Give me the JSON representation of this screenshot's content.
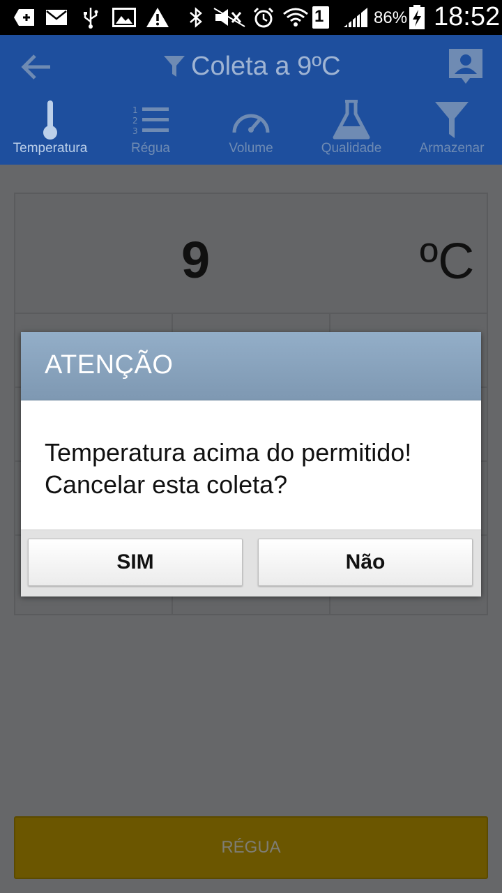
{
  "status_bar": {
    "battery_percent": "86%",
    "time": "18:52",
    "sim_slot": "1",
    "icons": [
      "add-notification-icon",
      "mail-icon",
      "usb-icon",
      "image-icon",
      "warning-icon",
      "bluetooth-icon",
      "mute-icon",
      "alarm-icon",
      "wifi-icon",
      "sim-icon",
      "signal-icon",
      "battery-charging-icon"
    ]
  },
  "appbar": {
    "title": "Coleta a 9ºC",
    "tabs": [
      {
        "label": "Temperatura",
        "icon": "thermometer-icon",
        "active": true
      },
      {
        "label": "Régua",
        "icon": "numbered-list-icon",
        "active": false
      },
      {
        "label": "Volume",
        "icon": "gauge-icon",
        "active": false
      },
      {
        "label": "Qualidade",
        "icon": "flask-icon",
        "active": false
      },
      {
        "label": "Armazenar",
        "icon": "filter-icon",
        "active": false
      }
    ]
  },
  "temperature": {
    "value": "9",
    "unit": "ºC"
  },
  "bottom_button": {
    "label": "RÉGUA"
  },
  "dialog": {
    "title": "ATENÇÃO",
    "message_line1": "Temperatura acima do permitido!",
    "message_line2": "Cancelar esta coleta?",
    "yes_label": "SIM",
    "no_label": "Não"
  },
  "colors": {
    "appbar": "#1e4f9e",
    "dialog_header": "#8aa5bf",
    "overlay": "#666769",
    "bottom_button": "#6b5600"
  }
}
